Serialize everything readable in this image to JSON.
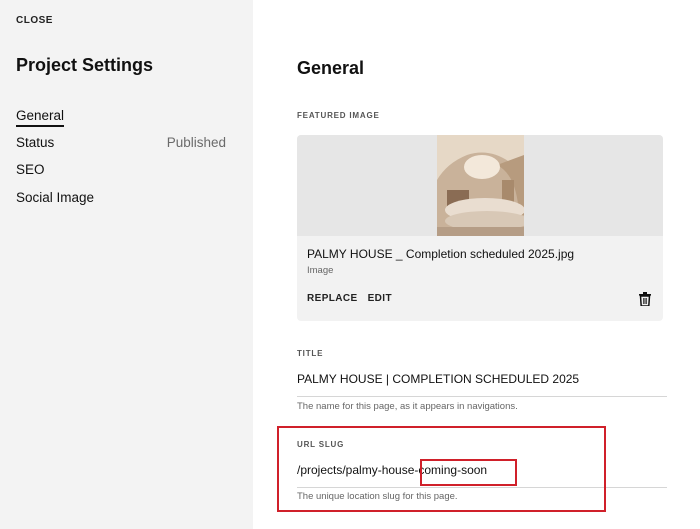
{
  "sidebar": {
    "close_label": "CLOSE",
    "title": "Project Settings",
    "items": [
      {
        "label": "General",
        "value": ""
      },
      {
        "label": "Status",
        "value": "Published"
      },
      {
        "label": "SEO",
        "value": ""
      },
      {
        "label": "Social Image",
        "value": ""
      }
    ]
  },
  "main": {
    "heading": "General",
    "featured_image": {
      "section_label": "FEATURED IMAGE",
      "file_name": "PALMY HOUSE _ Completion scheduled 2025.jpg",
      "file_type": "Image",
      "replace_label": "REPLACE",
      "edit_label": "EDIT",
      "delete_icon": "trash-icon"
    },
    "title_field": {
      "label": "TITLE",
      "value": "PALMY HOUSE | COMPLETION SCHEDULED 2025",
      "help": "The name for this page, as it appears in navigations."
    },
    "slug_field": {
      "label": "URL SLUG",
      "value": "/projects/palmy-house-coming-soon",
      "help": "The unique location slug for this page."
    }
  },
  "annotation": {
    "color": "#d0202a"
  }
}
